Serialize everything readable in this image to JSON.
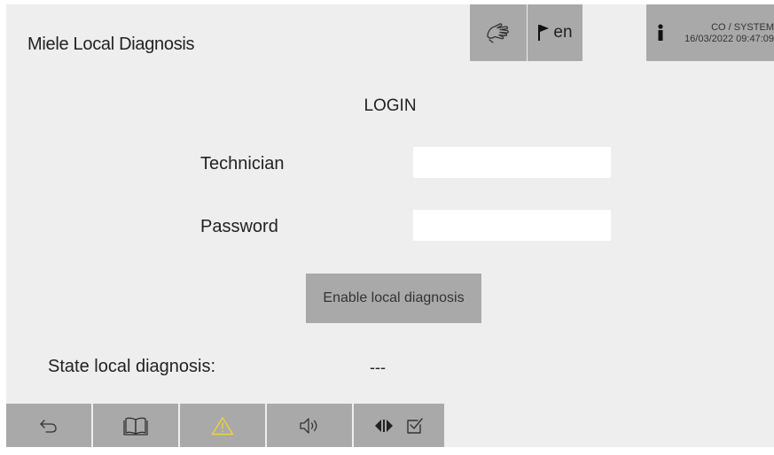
{
  "header": {
    "title": "Miele Local Diagnosis",
    "icons": [
      "hand-touch-icon",
      "flag-icon",
      "info-icon"
    ],
    "language": "en",
    "user": "CO / SYSTEM",
    "datetime": "16/03/2022 09:47:09"
  },
  "login": {
    "title": "LOGIN",
    "technician_label": "Technician",
    "technician_value": "",
    "password_label": "Password",
    "password_value": "",
    "enable_button": "Enable local diagnosis",
    "state_label": "State local diagnosis:",
    "state_value": "---"
  },
  "footer": {
    "icons": [
      "back-icon",
      "manual-book-icon",
      "warning-icon",
      "speaker-icon",
      "media-switch-icon",
      "checkbox-icon"
    ]
  },
  "colors": {
    "background": "#eeeeee",
    "button_gray": "#a9a9a9",
    "input_white": "#ffffff",
    "warning_yellow": "#f1d23a"
  }
}
